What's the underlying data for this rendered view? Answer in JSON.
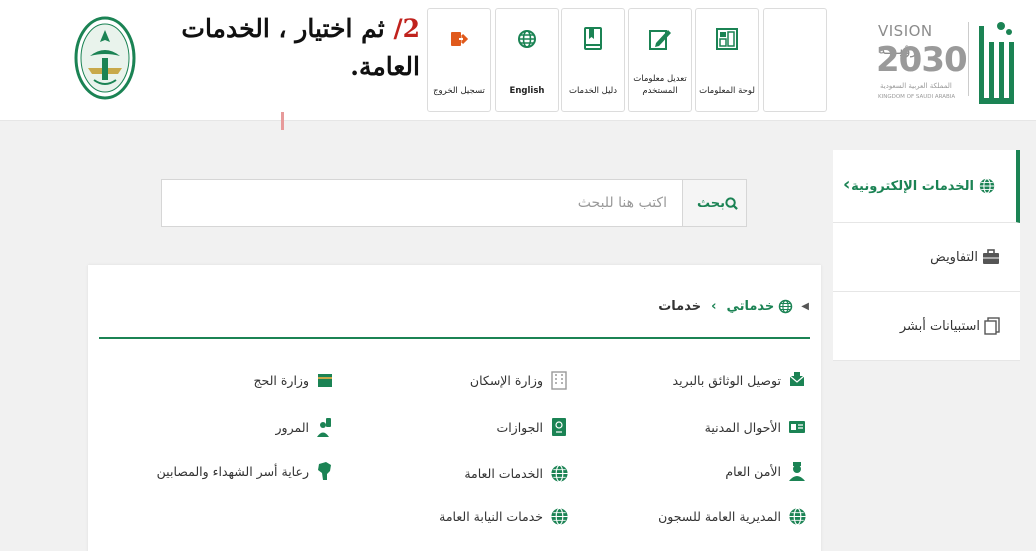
{
  "header": {
    "annotation_step": "2/",
    "annotation_text": "ثم اختيار ، الخدمات العامة.",
    "tiles": {
      "logout": "تسجيل الخروج",
      "english": "English",
      "guide": "دليل الخدمات",
      "profile": "تعديل معلومات المستخدم",
      "dashboard": "لوحة المعلومات"
    },
    "vision": {
      "line1": "VISION رؤيـــة",
      "year": "2030",
      "ksa_ar": "المملكة العربية السعودية",
      "ksa_en": "KINGDOM OF SAUDI ARABIA"
    }
  },
  "sidebar": {
    "items": [
      {
        "label": "الخدمات الإلكترونية",
        "icon": "globe-icon"
      },
      {
        "label": "التفاويض",
        "icon": "briefcase-icon"
      },
      {
        "label": "استبيانات أبشر",
        "icon": "document-icon"
      }
    ]
  },
  "search": {
    "placeholder": "اكتب هنا للبحث",
    "button_label": "بحث"
  },
  "breadcrumb": {
    "home": "خدماتي",
    "separator": "›",
    "current": "خدمات"
  },
  "services": {
    "col1": [
      {
        "label": "توصيل الوثائق بالبريد",
        "icon": "mail-delivery-icon"
      },
      {
        "label": "الأحوال المدنية",
        "icon": "id-card-icon"
      },
      {
        "label": "الأمن العام",
        "icon": "officer-icon"
      },
      {
        "label": "المديرية العامة للسجون",
        "icon": "globe-icon"
      }
    ],
    "col2": [
      {
        "label": "وزارة الإسكان",
        "icon": "building-icon"
      },
      {
        "label": "الجوازات",
        "icon": "passport-icon"
      },
      {
        "label": "الخدمات العامة",
        "icon": "globe-icon"
      },
      {
        "label": "خدمات النيابة العامة",
        "icon": "globe-icon"
      }
    ],
    "col3": [
      {
        "label": "وزارة الحج",
        "icon": "kaaba-icon"
      },
      {
        "label": "المرور",
        "icon": "traffic-officer-icon"
      },
      {
        "label": "رعاية أسر الشهداء والمصابين",
        "icon": "map-icon"
      }
    ]
  },
  "colors": {
    "primary_green": "#1b8354",
    "logout_orange": "#e05a1c",
    "annotation_red": "#c0221d"
  }
}
